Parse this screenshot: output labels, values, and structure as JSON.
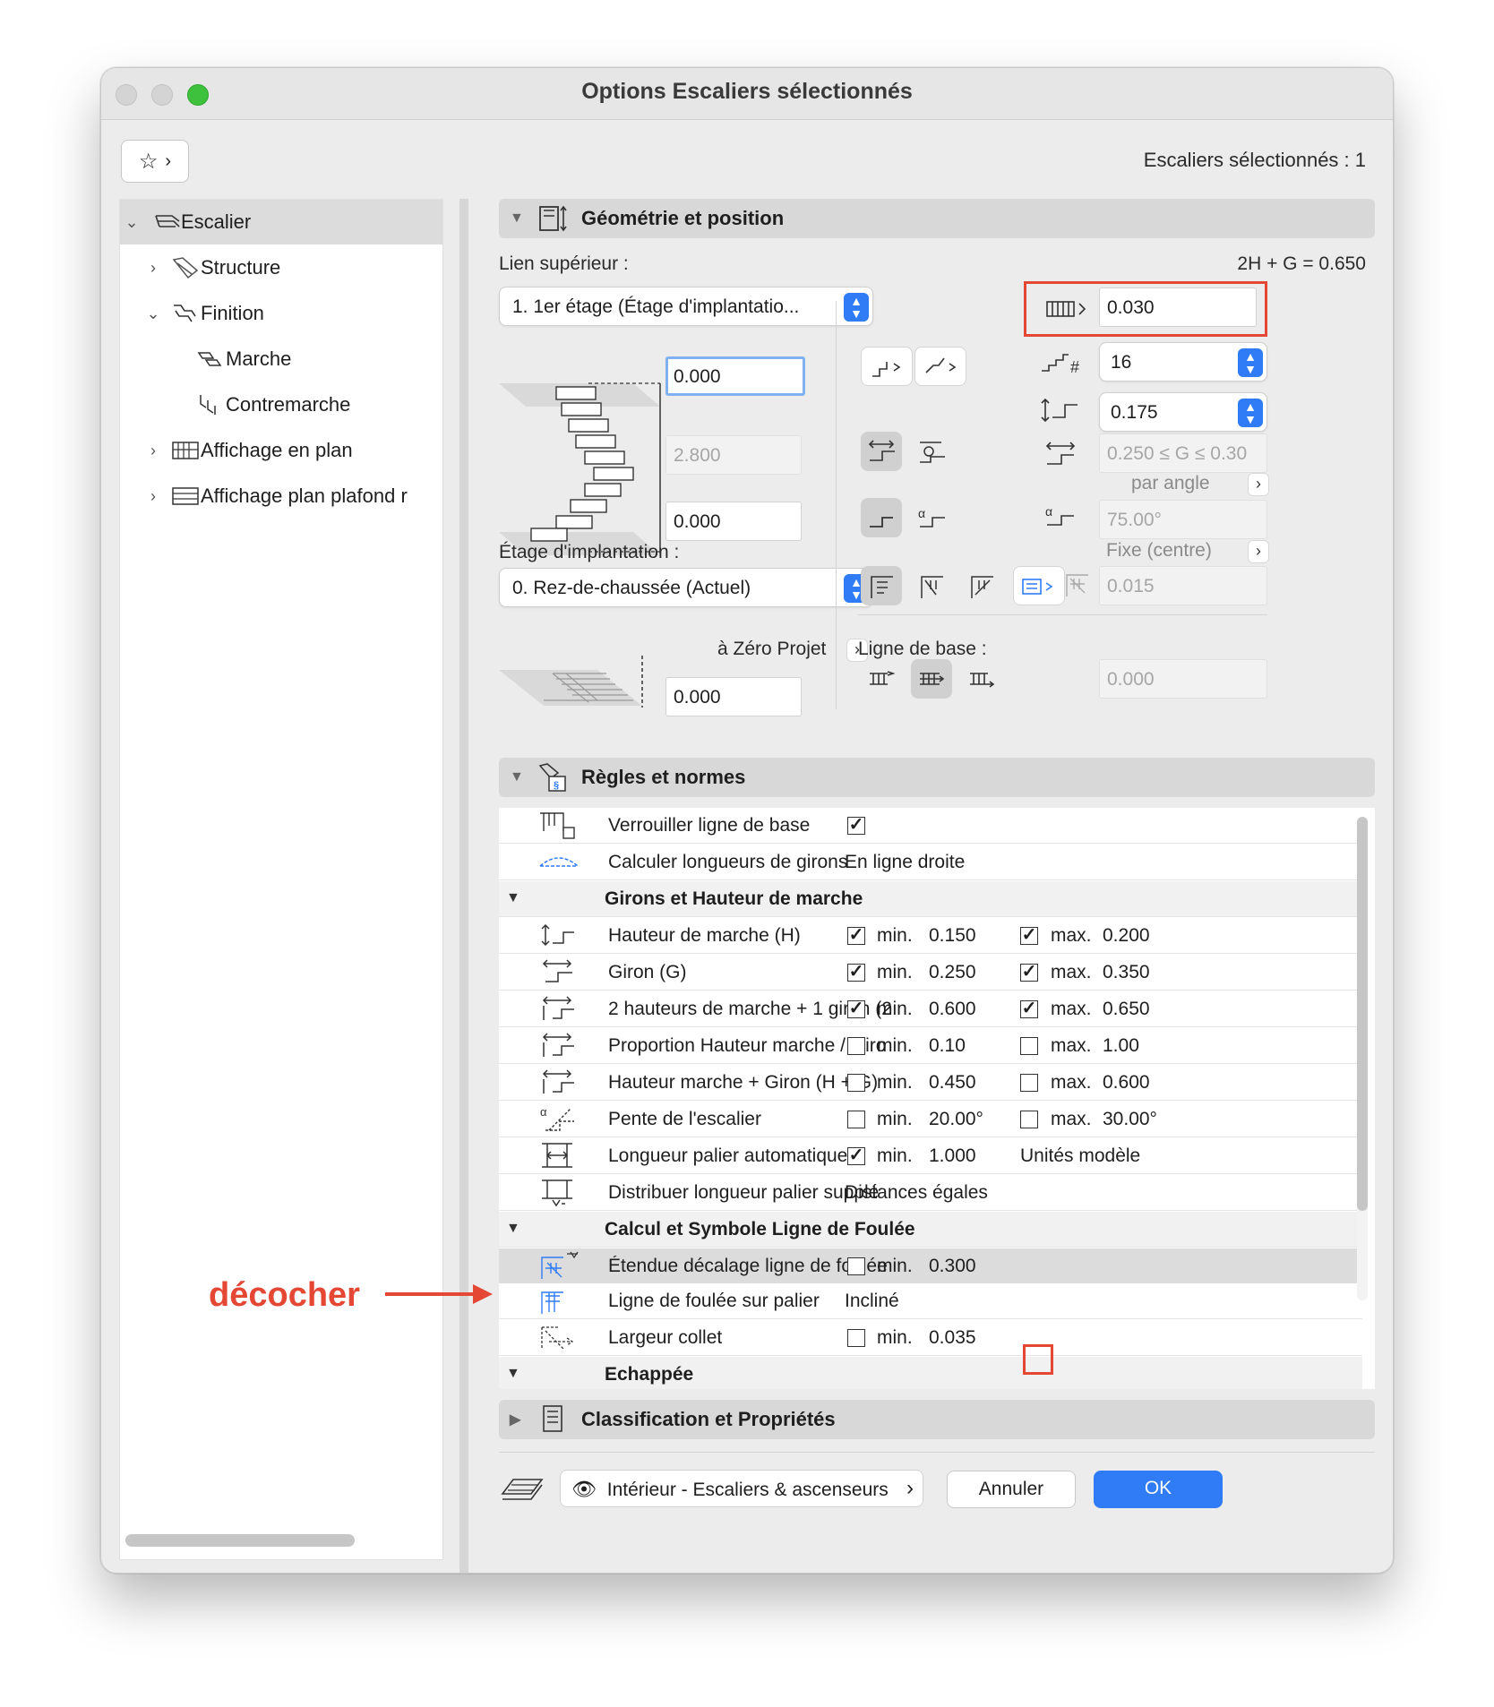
{
  "window": {
    "title": "Options Escaliers sélectionnés"
  },
  "header": {
    "selected_count": "Escaliers sélectionnés : 1"
  },
  "sidebar": {
    "items": [
      {
        "label": "Escalier"
      },
      {
        "label": "Structure"
      },
      {
        "label": "Finition"
      },
      {
        "label": "Marche"
      },
      {
        "label": "Contremarche"
      },
      {
        "label": "Affichage en plan"
      },
      {
        "label": "Affichage plan plafond r"
      }
    ]
  },
  "geometry": {
    "title": "Géométrie et position",
    "lien_superieur_label": "Lien supérieur :",
    "lien_superieur_value": "1. 1er étage (Étage d'implantatio...",
    "formula": "2H + G = 0.650",
    "offset_top": "0.000",
    "height": "2.800",
    "offset_bottom": "0.000",
    "etage_label": "Étage d'implantation :",
    "etage_value": "0. Rez-de-chaussée (Actuel)",
    "zero_projet_label": "à Zéro Projet",
    "zero_projet_value": "0.000",
    "nosing_value": "0.030",
    "risers_count": "16",
    "riser_height": "0.175",
    "tread_range": "0.250 ≤ G ≤ 0.30",
    "par_angle_label": "par angle",
    "angle_value": "75.00°",
    "fixe_label": "Fixe (centre)",
    "walkline_offset": "0.015",
    "ligne_base_label": "Ligne de base :",
    "ligne_base_value": "0.000"
  },
  "rules": {
    "title": "Règles et normes",
    "rows": [
      {
        "name": "Verrouiller ligne de base",
        "check": true
      },
      {
        "name": "Calculer longueurs de girons",
        "value": "En ligne droite"
      },
      {
        "name": "Girons et Hauteur de marche",
        "group": true
      },
      {
        "name": "Hauteur de marche (H)",
        "min_check": true,
        "min_label": "min.",
        "min": "0.150",
        "max_check": true,
        "max_label": "max.",
        "max": "0.200"
      },
      {
        "name": "Giron (G)",
        "min_check": true,
        "min_label": "min.",
        "min": "0.250",
        "max_check": true,
        "max_label": "max.",
        "max": "0.350"
      },
      {
        "name": "2 hauteurs de marche + 1 giron (2",
        "min_check": true,
        "min_label": "min.",
        "min": "0.600",
        "max_check": true,
        "max_label": "max.",
        "max": "0.650"
      },
      {
        "name": "Proportion Hauteur marche / Giro",
        "min_check": false,
        "min_label": "min.",
        "min": "0.10",
        "max_check": false,
        "max_label": "max.",
        "max": "1.00"
      },
      {
        "name": "Hauteur marche + Giron (H + G)",
        "min_check": false,
        "min_label": "min.",
        "min": "0.450",
        "max_check": false,
        "max_label": "max.",
        "max": "0.600"
      },
      {
        "name": "Pente de l'escalier",
        "min_check": false,
        "min_label": "min.",
        "min": "20.00°",
        "max_check": false,
        "max_label": "max.",
        "max": "30.00°"
      },
      {
        "name": "Longueur palier automatique",
        "min_check": true,
        "min_label": "min.",
        "min": "1.000",
        "extra": "Unités modèle"
      },
      {
        "name": "Distribuer longueur palier supplé",
        "value": "Distances égales"
      },
      {
        "name": "Calcul et Symbole Ligne de Foulée",
        "group": true
      },
      {
        "name": "Étendue décalage ligne de foulée",
        "min_check": false,
        "min_label": "min.",
        "min": "0.300",
        "highlight": true
      },
      {
        "name": "Ligne de foulée sur palier",
        "value": "Incliné"
      },
      {
        "name": "Largeur collet",
        "min_check": false,
        "min_label": "min.",
        "min": "0.035"
      },
      {
        "name": "Echappée",
        "group": true
      }
    ]
  },
  "classification": {
    "title": "Classification et Propriétés"
  },
  "footer": {
    "favorite_label": "Intérieur - Escaliers & ascenseurs",
    "cancel": "Annuler",
    "ok": "OK"
  },
  "annotation": {
    "text": "décocher"
  },
  "colors": {
    "accent": "#2f7cf6",
    "annotation": "#e54735"
  }
}
